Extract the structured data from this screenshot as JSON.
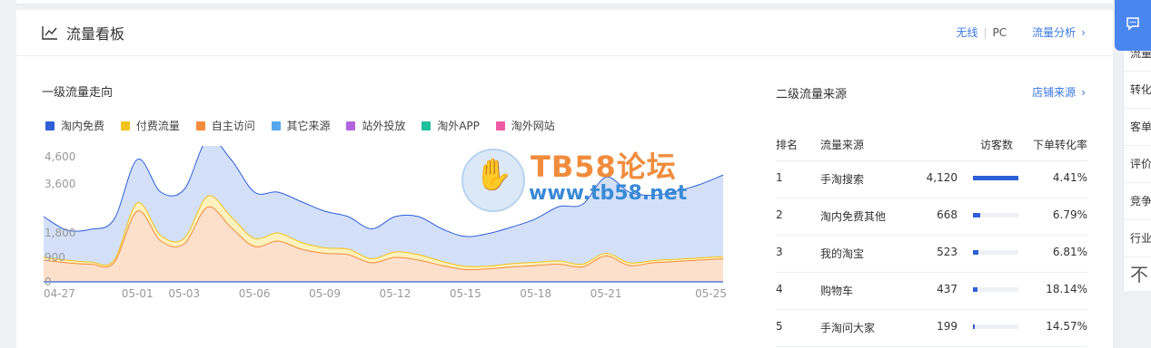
{
  "header": {
    "title": "流量看板",
    "link_wireless": "无线",
    "separator": "|",
    "link_pc": "PC",
    "link_analysis": "流量分析",
    "chevron": "›"
  },
  "left": {
    "title": "一级流量走向",
    "legend": [
      {
        "label": "淘内免费",
        "color": "#2e5fd8"
      },
      {
        "label": "付费流量",
        "color": "#f1c21a"
      },
      {
        "label": "自主访问",
        "color": "#f28b3b"
      },
      {
        "label": "其它来源",
        "color": "#57a7ee"
      },
      {
        "label": "站外投放",
        "color": "#b264de"
      },
      {
        "label": "淘外APP",
        "color": "#1cc09a"
      },
      {
        "label": "淘外网站",
        "color": "#ef5aa5"
      }
    ]
  },
  "chart_data": {
    "type": "area",
    "x": [
      "04-27",
      "04-28",
      "04-29",
      "04-30",
      "05-01",
      "05-02",
      "05-03",
      "05-04",
      "05-05",
      "05-06",
      "05-07",
      "05-08",
      "05-09",
      "05-10",
      "05-11",
      "05-12",
      "05-13",
      "05-14",
      "05-15",
      "05-16",
      "05-17",
      "05-18",
      "05-19",
      "05-20",
      "05-21",
      "05-22",
      "05-23",
      "05-24",
      "05-25",
      "05-26"
    ],
    "xticks": [
      "04-27",
      "05-01",
      "05-03",
      "05-06",
      "05-09",
      "05-12",
      "05-15",
      "05-18",
      "05-21",
      "05-25"
    ],
    "yticks": [
      "4,600",
      "3,600",
      "1,800",
      "900",
      "0"
    ],
    "ylim": [
      0,
      4600
    ],
    "series": [
      {
        "name": "自主访问",
        "color": "#f28b3b",
        "fill": "#fde0cc",
        "values": [
          800,
          700,
          650,
          700,
          2600,
          1500,
          1400,
          2750,
          2000,
          1300,
          1500,
          1200,
          1050,
          1000,
          700,
          900,
          800,
          600,
          450,
          480,
          550,
          600,
          650,
          550,
          950,
          600,
          700,
          750,
          800,
          850
        ]
      },
      {
        "name": "付费流量",
        "color": "#f1c21a",
        "fill": "#fdf1bd",
        "values": [
          100,
          100,
          80,
          90,
          300,
          200,
          200,
          400,
          400,
          300,
          300,
          250,
          200,
          200,
          150,
          200,
          200,
          150,
          120,
          100,
          120,
          120,
          120,
          100,
          100,
          100,
          80,
          80,
          80,
          80
        ]
      },
      {
        "name": "淘内免费",
        "color": "#2e5fd8",
        "fill": "#d3e0f8",
        "values": [
          1500,
          1100,
          1200,
          1500,
          1600,
          1600,
          1800,
          2100,
          2100,
          1700,
          1500,
          1500,
          1350,
          1200,
          1100,
          1300,
          1400,
          1200,
          1100,
          1200,
          1350,
          1600,
          2000,
          2200,
          2800,
          2600,
          2400,
          2500,
          2700,
          3000
        ]
      }
    ]
  },
  "watermark": {
    "text1": "TB58论坛",
    "text2": "www.tb58.net"
  },
  "right": {
    "title": "二级流量来源",
    "link": "店铺来源",
    "headers": {
      "rank": "排名",
      "source": "流量来源",
      "visitors": "访客数",
      "rate": "下单转化率"
    },
    "rows": [
      {
        "rank": "1",
        "source": "手淘搜索",
        "visitors": "4,120",
        "share": 1.0,
        "rate": "4.41%"
      },
      {
        "rank": "2",
        "source": "淘内免费其他",
        "visitors": "668",
        "share": 0.162,
        "rate": "6.79%"
      },
      {
        "rank": "3",
        "source": "我的淘宝",
        "visitors": "523",
        "share": 0.127,
        "rate": "6.81%"
      },
      {
        "rank": "4",
        "source": "购物车",
        "visitors": "437",
        "share": 0.106,
        "rate": "18.14%"
      },
      {
        "rank": "5",
        "source": "手淘问大家",
        "visitors": "199",
        "share": 0.048,
        "rate": "14.57%"
      }
    ]
  },
  "side_menu": {
    "items": [
      "流量",
      "转化",
      "客单",
      "评价",
      "竞争",
      "行业"
    ],
    "back_to_top": "不"
  }
}
